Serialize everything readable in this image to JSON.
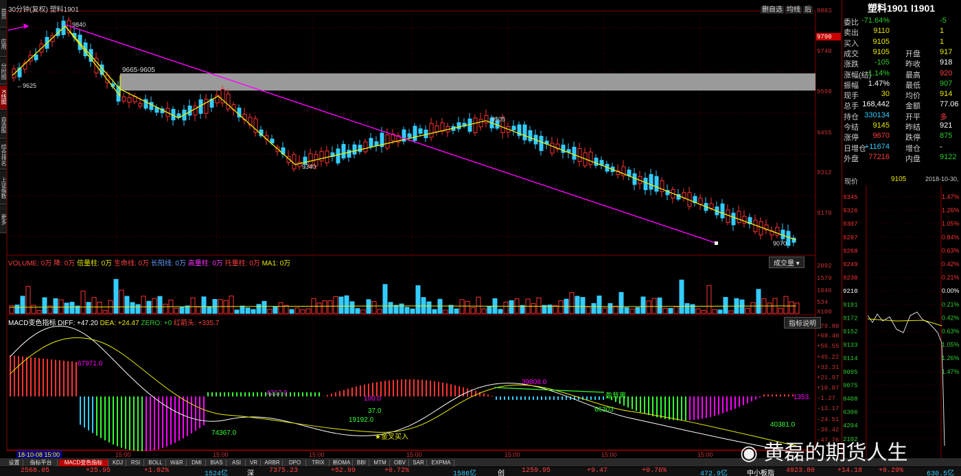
{
  "window": {
    "title": "30分钟(复权) 塑料1901",
    "buttons": [
      "删自选",
      "均线",
      "后"
    ]
  },
  "left_nav": [
    "首页",
    "应用",
    "分时图",
    "K线图",
    "自选股",
    "综合排名",
    "上证指数",
    "更多"
  ],
  "main_axis": {
    "labels": [
      "9883",
      "9790",
      "9740",
      "9598",
      "9455",
      "9312",
      "9170"
    ],
    "highlight": "9790"
  },
  "annotations": {
    "high": "9840",
    "low_left": "9625",
    "zone": "9665-9605",
    "mid_low": "9340",
    "mid_high": "9505",
    "last_low": "9070"
  },
  "volume": {
    "header": {
      "volume": "VOLUME: 0万",
      "down": "降: 0万",
      "bei": "倍量柱: 0万",
      "sheng": "生命线: 0万",
      "chang": "长阳线: 0万",
      "gao": "高量柱: 0万",
      "tuo": "托量柱: 0万",
      "ma": "MA1: 0万"
    },
    "button": "成交量",
    "axis": [
      "2092",
      "1579",
      "1046",
      "534",
      "X100"
    ]
  },
  "macd": {
    "header": {
      "name": "MACD变色指标",
      "diff": "DIFF: +47.20",
      "dea": "DEA: +24.47",
      "zero": "ZERO: +0",
      "hong": "红箭头: +335.7"
    },
    "button": "指标说明",
    "axis": [
      "+79.80",
      "+68.46",
      "+56.55",
      "+45.22",
      "+33.31",
      "+21.97",
      "+10.07",
      "-1.27",
      "-13.17",
      "-24.51",
      "-36.42",
      "-47.76"
    ],
    "labels": [
      "67971.0",
      "74367.0",
      "4217.0",
      "100.0",
      "37.0",
      "19192.0",
      "金叉买入",
      "39808.0",
      "盈背离",
      "66303",
      "40381.0",
      "1353."
    ]
  },
  "time_axis": [
    "18-10-08 15:00",
    "15:00",
    "15:00",
    "15:00",
    "15:00",
    "15:00"
  ],
  "right_panel": {
    "title": "塑料1901 l1901",
    "rows": [
      {
        "k": "委比",
        "v1": "-71.64%",
        "c1": "green",
        "k2": "",
        "v2": "-5",
        "c2": "green"
      },
      {
        "k": "卖出",
        "v1": "9110",
        "c1": "yellow",
        "k2": "",
        "v2": "1",
        "c2": "yellow"
      },
      {
        "k": "买入",
        "v1": "9105",
        "c1": "yellow",
        "k2": "",
        "v2": "1",
        "c2": "yellow"
      },
      {
        "k": "成交",
        "v1": "9105",
        "c1": "yellow",
        "k2": "开盘",
        "v2": "917",
        "c2": "yellow"
      },
      {
        "k": "涨跌",
        "v1": "-105",
        "c1": "green",
        "k2": "昨收",
        "v2": "918",
        "c2": "white"
      },
      {
        "k": "涨幅(结)",
        "v1": "-1.14%",
        "c1": "green",
        "k2": "最高",
        "v2": "920",
        "c2": "red"
      },
      {
        "k": "振幅",
        "v1": "1.47%",
        "c1": "white",
        "k2": "最低",
        "v2": "907",
        "c2": "green"
      },
      {
        "k": "现手",
        "v1": "30",
        "c1": "yellow",
        "k2": "均价",
        "v2": "914",
        "c2": "yellow"
      },
      {
        "k": "总手",
        "v1": "168,442",
        "c1": "white",
        "k2": "金额",
        "v2": "77.06",
        "c2": "white"
      },
      {
        "k": "持仓",
        "v1": "330134",
        "c1": "cyan",
        "k2": "开平",
        "v2": "多",
        "c2": "red"
      },
      {
        "k": "今结",
        "v1": "9145",
        "c1": "yellow",
        "k2": "昨结",
        "v2": "921",
        "c2": "white"
      },
      {
        "k": "涨停",
        "v1": "9670",
        "c1": "red",
        "k2": "跌停",
        "v2": "875",
        "c2": "green"
      },
      {
        "k": "日增仓",
        "v1": "+11674",
        "c1": "cyan",
        "k2": "增仓",
        "v2": "-",
        "c2": "white"
      },
      {
        "k": "外盘",
        "v1": "77216",
        "c1": "red",
        "k2": "内盘",
        "v2": "9122",
        "c2": "green"
      }
    ],
    "intraday": {
      "label": "现价",
      "price": "9105",
      "date": "2018-10-30,",
      "left_axis": [
        "9345",
        "9326",
        "9307",
        "9287",
        "9268",
        "9249",
        "9230",
        "9210",
        "9191",
        "9172",
        "9152",
        "9133",
        "9114",
        "9095",
        "9075",
        "8408",
        "6306",
        "4204",
        "2102"
      ],
      "right_axis": [
        "1.47%",
        "1.26%",
        "1.05%",
        "0.84%",
        "0.63%",
        "0.42%",
        "0.21%",
        "0.00%",
        "0.21%",
        "0.42%",
        "0.63%",
        "1.05%",
        "1.26%",
        "1.47%"
      ]
    }
  },
  "tabs": [
    "设置",
    "指标平台",
    "MACD变色指标",
    "KDJ",
    "RSI",
    "BOLL",
    "W&R",
    "DMI",
    "BIAS",
    "ASI",
    "VR",
    "ARBR",
    "DPO",
    "TRIX",
    "新DMA",
    "BBI",
    "MTM",
    "OBV",
    "SAR",
    "EXPMA"
  ],
  "status": {
    "s1": "2568.05",
    "s2": "+25.95",
    "s3": "+1.02%",
    "s4": "1524亿",
    "s5": "深",
    "s6": "7375.23",
    "s7": "+52.99",
    "s8": "+0.72%",
    "s9": "1586亿",
    "s10": "创",
    "s11": "1259.95",
    "s12": "+9.47",
    "s13": "+0.76%",
    "s14": "472.9亿",
    "s15": "中小板指",
    "s16": "4923.80",
    "s17": "+14.18",
    "s18": "+0.29%",
    "s19": "630.5亿"
  },
  "watermark": "黄磊的期货人生"
}
